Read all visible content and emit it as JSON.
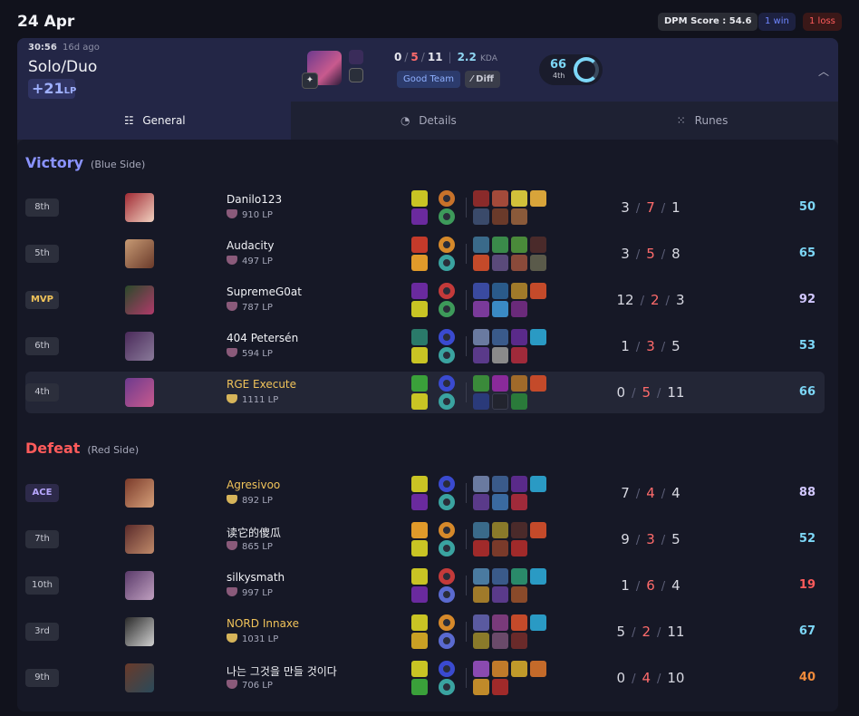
{
  "header": {
    "date": "24 Apr",
    "dpm_score": "DPM Score : 54.6",
    "wins": "1 win",
    "losses": "1 loss"
  },
  "match": {
    "duration": "30:56",
    "ago": "16d ago",
    "queue": "Solo/Duo",
    "lp_change": "+21",
    "lp_unit": "LP",
    "kills": "0",
    "deaths": "5",
    "assists": "11",
    "kda": "2.2",
    "kda_label": "KDA",
    "tag_good": "Good Team",
    "tag_diff": "Diff",
    "score": "66",
    "score_rank": "4th",
    "ring_progress": 0.66,
    "champion_icon": "champion-portrait"
  },
  "tabs": [
    {
      "label": "General",
      "icon": "list-icon",
      "active": true
    },
    {
      "label": "Details",
      "icon": "pie-chart-icon",
      "active": false
    },
    {
      "label": "Runes",
      "icon": "grid-dots-icon",
      "active": false
    }
  ],
  "teams": [
    {
      "result": "Victory",
      "side": "(Blue Side)",
      "color": "#8a93ff",
      "players": [
        {
          "rank": "8th",
          "name": "Danilo123",
          "lp": "910 LP",
          "k": "3",
          "d": "7",
          "a": "1",
          "score": "50",
          "score_color": "#7dd7f7",
          "portrait": [
            "#a02a34",
            "#f1d1c0"
          ],
          "spells": [
            "#c9c424",
            "#6b2a9e"
          ],
          "runes": [
            "#c7722a",
            "#3d9a5a"
          ],
          "items": [
            "#8a2a2a",
            "#a34a3a",
            "#d1c13a",
            "#d8a43a",
            "#3a4a6a",
            "#6a3a2a",
            "#8a5a3a"
          ]
        },
        {
          "rank": "5th",
          "name": "Audacity",
          "lp": "497 LP",
          "k": "3",
          "d": "5",
          "a": "8",
          "score": "65",
          "score_color": "#7dd7f7",
          "portrait": [
            "#c79a74",
            "#6a3a2a"
          ],
          "spells": [
            "#c43a2a",
            "#e09a2a"
          ],
          "runes": [
            "#d6892a",
            "#3aa3a0"
          ],
          "items": [
            "#3a6a8a",
            "#3a8a4a",
            "#4a8a3a",
            "#4a2a2a",
            "#c44a2a",
            "#5a4a7a",
            "#8a4a3a",
            "#5a5a4a"
          ]
        },
        {
          "rank": "MVP",
          "name": "SupremeG0at",
          "lp": "787 LP",
          "k": "12",
          "d": "2",
          "a": "3",
          "score": "92",
          "score_color": "#d2c8ff",
          "portrait": [
            "#2a4a2a",
            "#b03a6a"
          ],
          "spells": [
            "#6a2a9e",
            "#c9c424"
          ],
          "runes": [
            "#c43a3a",
            "#3d9a5a"
          ],
          "items": [
            "#3a4aa0",
            "#2a5a8a",
            "#a07a2a",
            "#c44a2a",
            "#7a3a9a",
            "#3a8ac4",
            "#6a2a7a"
          ]
        },
        {
          "rank": "6th",
          "name": "404 Petersén",
          "lp": "594 LP",
          "k": "1",
          "d": "3",
          "a": "5",
          "score": "53",
          "score_color": "#7dd7f7",
          "portrait": [
            "#4a2a5a",
            "#8a7a9a"
          ],
          "spells": [
            "#2a7a6a",
            "#c9c424"
          ],
          "runes": [
            "#3a4ad0",
            "#3aa3a0"
          ],
          "items": [
            "#6a7aa0",
            "#3a5a8a",
            "#5a2a8a",
            "#2a9ac4",
            "#5a3a8a",
            "#8a8a8a",
            "#a02a3a"
          ]
        },
        {
          "rank": "4th",
          "name": "RGE Execute",
          "lp": "1111 LP",
          "k": "0",
          "d": "5",
          "a": "11",
          "score": "66",
          "score_color": "#7dd7f7",
          "portrait": [
            "#6d3a8e",
            "#c85a8e"
          ],
          "spells": [
            "#3aa03a",
            "#c9c424"
          ],
          "runes": [
            "#3a4ad0",
            "#3aa3a0"
          ],
          "items": [
            "#3a8a3a",
            "#8a2a9a",
            "#a06a2a",
            "#c44a2a",
            "#2a3a7a",
            "#22242e",
            "#2a7a3a"
          ],
          "highlight": true,
          "gold": true
        }
      ]
    },
    {
      "result": "Defeat",
      "side": "(Red Side)",
      "color": "#ff5b5b",
      "players": [
        {
          "rank": "ACE",
          "name": "Agresivoo",
          "lp": "892 LP",
          "k": "7",
          "d": "4",
          "a": "4",
          "score": "88",
          "score_color": "#d2c8ff",
          "portrait": [
            "#7a3a2a",
            "#d6a07a"
          ],
          "spells": [
            "#c9c424",
            "#6a2a9e"
          ],
          "runes": [
            "#3a4ad0",
            "#3aa3a0"
          ],
          "items": [
            "#6a7aa0",
            "#3a5a8a",
            "#5a2a8a",
            "#2a9ac4",
            "#5a3a8a",
            "#3a6aa0",
            "#a02a3a"
          ],
          "gold": true
        },
        {
          "rank": "7th",
          "name": "读它的傻瓜",
          "lp": "865 LP",
          "k": "9",
          "d": "3",
          "a": "5",
          "score": "52",
          "score_color": "#7dd7f7",
          "portrait": [
            "#5a2a2a",
            "#c08a6a"
          ],
          "spells": [
            "#e09a2a",
            "#c9c424"
          ],
          "runes": [
            "#d6892a",
            "#3aa3a0"
          ],
          "items": [
            "#3a6a8a",
            "#8a7a2a",
            "#4a2a2a",
            "#c44a2a",
            "#a02a2a",
            "#7a3a2a",
            "#a02a2a"
          ]
        },
        {
          "rank": "10th",
          "name": "silkysmath",
          "lp": "997 LP",
          "k": "1",
          "d": "6",
          "a": "4",
          "score": "19",
          "score_color": "#ff5b5b",
          "portrait": [
            "#5a3a6a",
            "#c0a0c0"
          ],
          "spells": [
            "#c9c424",
            "#6a2a9e"
          ],
          "runes": [
            "#c43a3a",
            "#5a6ad0"
          ],
          "items": [
            "#4a7aa0",
            "#3a5a8a",
            "#2a8a6a",
            "#2a9ac4",
            "#a07a2a",
            "#5a3a8a",
            "#8a4a2a"
          ]
        },
        {
          "rank": "3rd",
          "name": "NORD Innaxe",
          "lp": "1031 LP",
          "k": "5",
          "d": "2",
          "a": "11",
          "score": "67",
          "score_color": "#7dd7f7",
          "portrait": [
            "#2a2a2a",
            "#d0d0d0"
          ],
          "spells": [
            "#c9c424",
            "#c9a024"
          ],
          "runes": [
            "#d6892a",
            "#5a6ad0"
          ],
          "items": [
            "#5a5aa0",
            "#7a3a7a",
            "#c44a2a",
            "#2a9ac4",
            "#8a7a2a",
            "#6a4a6a",
            "#6a2a2a"
          ],
          "gold": true
        },
        {
          "rank": "9th",
          "name": "나는 그것을 만들 것이다",
          "lp": "706 LP",
          "k": "0",
          "d": "4",
          "a": "10",
          "score": "40",
          "score_color": "#f08a3a",
          "portrait": [
            "#6a3a2a",
            "#2a4a5a"
          ],
          "spells": [
            "#c9c424",
            "#3aa03a"
          ],
          "runes": [
            "#3a4ad0",
            "#3aa3a0"
          ],
          "items": [
            "#8a4ab0",
            "#c07a2a",
            "#c09a2a",
            "#c46a2a",
            "#c08a2a",
            "#a02a2a"
          ]
        }
      ]
    }
  ]
}
